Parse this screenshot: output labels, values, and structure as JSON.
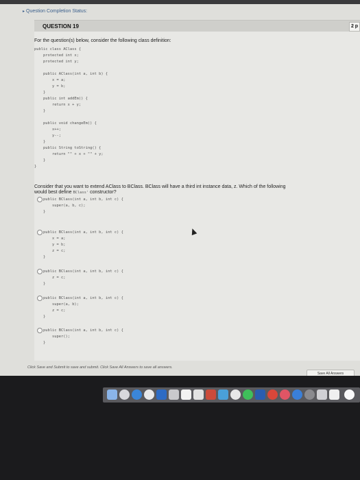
{
  "status": {
    "label": "Question Completion Status:"
  },
  "question": {
    "title": "QUESTION 19",
    "points": "2 p"
  },
  "prompt": "For the question(s) below, consider the following class definition:",
  "class_code": [
    "public class AClass {",
    "    protected int x;",
    "    protected int y;",
    "",
    "    public AClass(int a, int b) {",
    "        x = a;",
    "        y = b;",
    "    }",
    "    public int addEm() {",
    "        return x + y;",
    "    }",
    "",
    "    public void changeEm() {",
    "        x++;",
    "        y--;",
    "    }",
    "    public String toString() {",
    "        return \"\" + x + \"\" + y;",
    "    }",
    "}"
  ],
  "question_text": {
    "line1": "Consider that you want to extend AClass to BClass. BClass will have a third int instance data, z. Which of the following",
    "line2_pre": "would best define ",
    "line2_code": "BClass'",
    "line2_post": " constructor?"
  },
  "options": [
    {
      "lines": [
        "public BClass(int a, int b, int c) {",
        "    super(a, b, c);",
        "}"
      ]
    },
    {
      "lines": [
        "public BClass(int a, int b, int c) {",
        "    x = a;",
        "    y = b;",
        "    z = c;",
        "}"
      ]
    },
    {
      "lines": [
        "public BClass(int a, int b, int c) {",
        "    z = c;",
        "}"
      ]
    },
    {
      "lines": [
        "public BClass(int a, int b, int c) {",
        "    super(a, b);",
        "    z = c;",
        "}"
      ]
    },
    {
      "lines": [
        "public BClass(int a, int b, int c) {",
        "    super();",
        "}"
      ]
    }
  ],
  "footer": {
    "note": "Click Save and Submit to save and submit. Click Save All Answers to save all answers.",
    "save_all_label": "Save All Answers"
  },
  "colors": {
    "link_blue": "#3b5f8c",
    "page_bg": "#dfdfdb",
    "desk": "#1b1b1d"
  }
}
